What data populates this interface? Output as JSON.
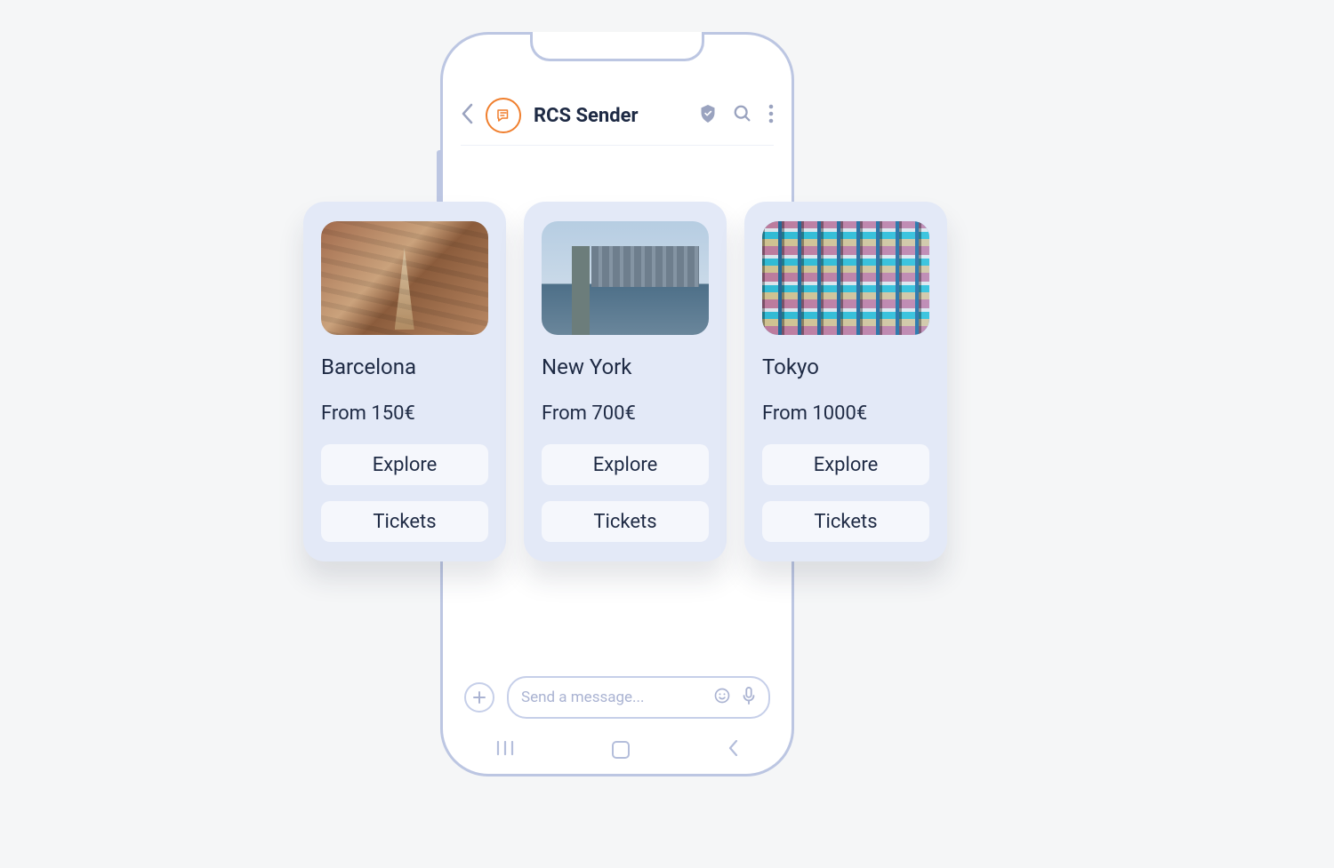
{
  "header": {
    "title": "RCS Sender"
  },
  "composer": {
    "placeholder": "Send a message..."
  },
  "cards": [
    {
      "title": "Barcelona",
      "price": "From 150€",
      "button_primary": "Explore",
      "button_secondary": "Tickets",
      "image": "barcelona"
    },
    {
      "title": "New York",
      "price": "From 700€",
      "button_primary": "Explore",
      "button_secondary": "Tickets",
      "image": "newyork"
    },
    {
      "title": "Tokyo",
      "price": "From 1000€",
      "button_primary": "Explore",
      "button_secondary": "Tickets",
      "image": "tokyo"
    }
  ]
}
